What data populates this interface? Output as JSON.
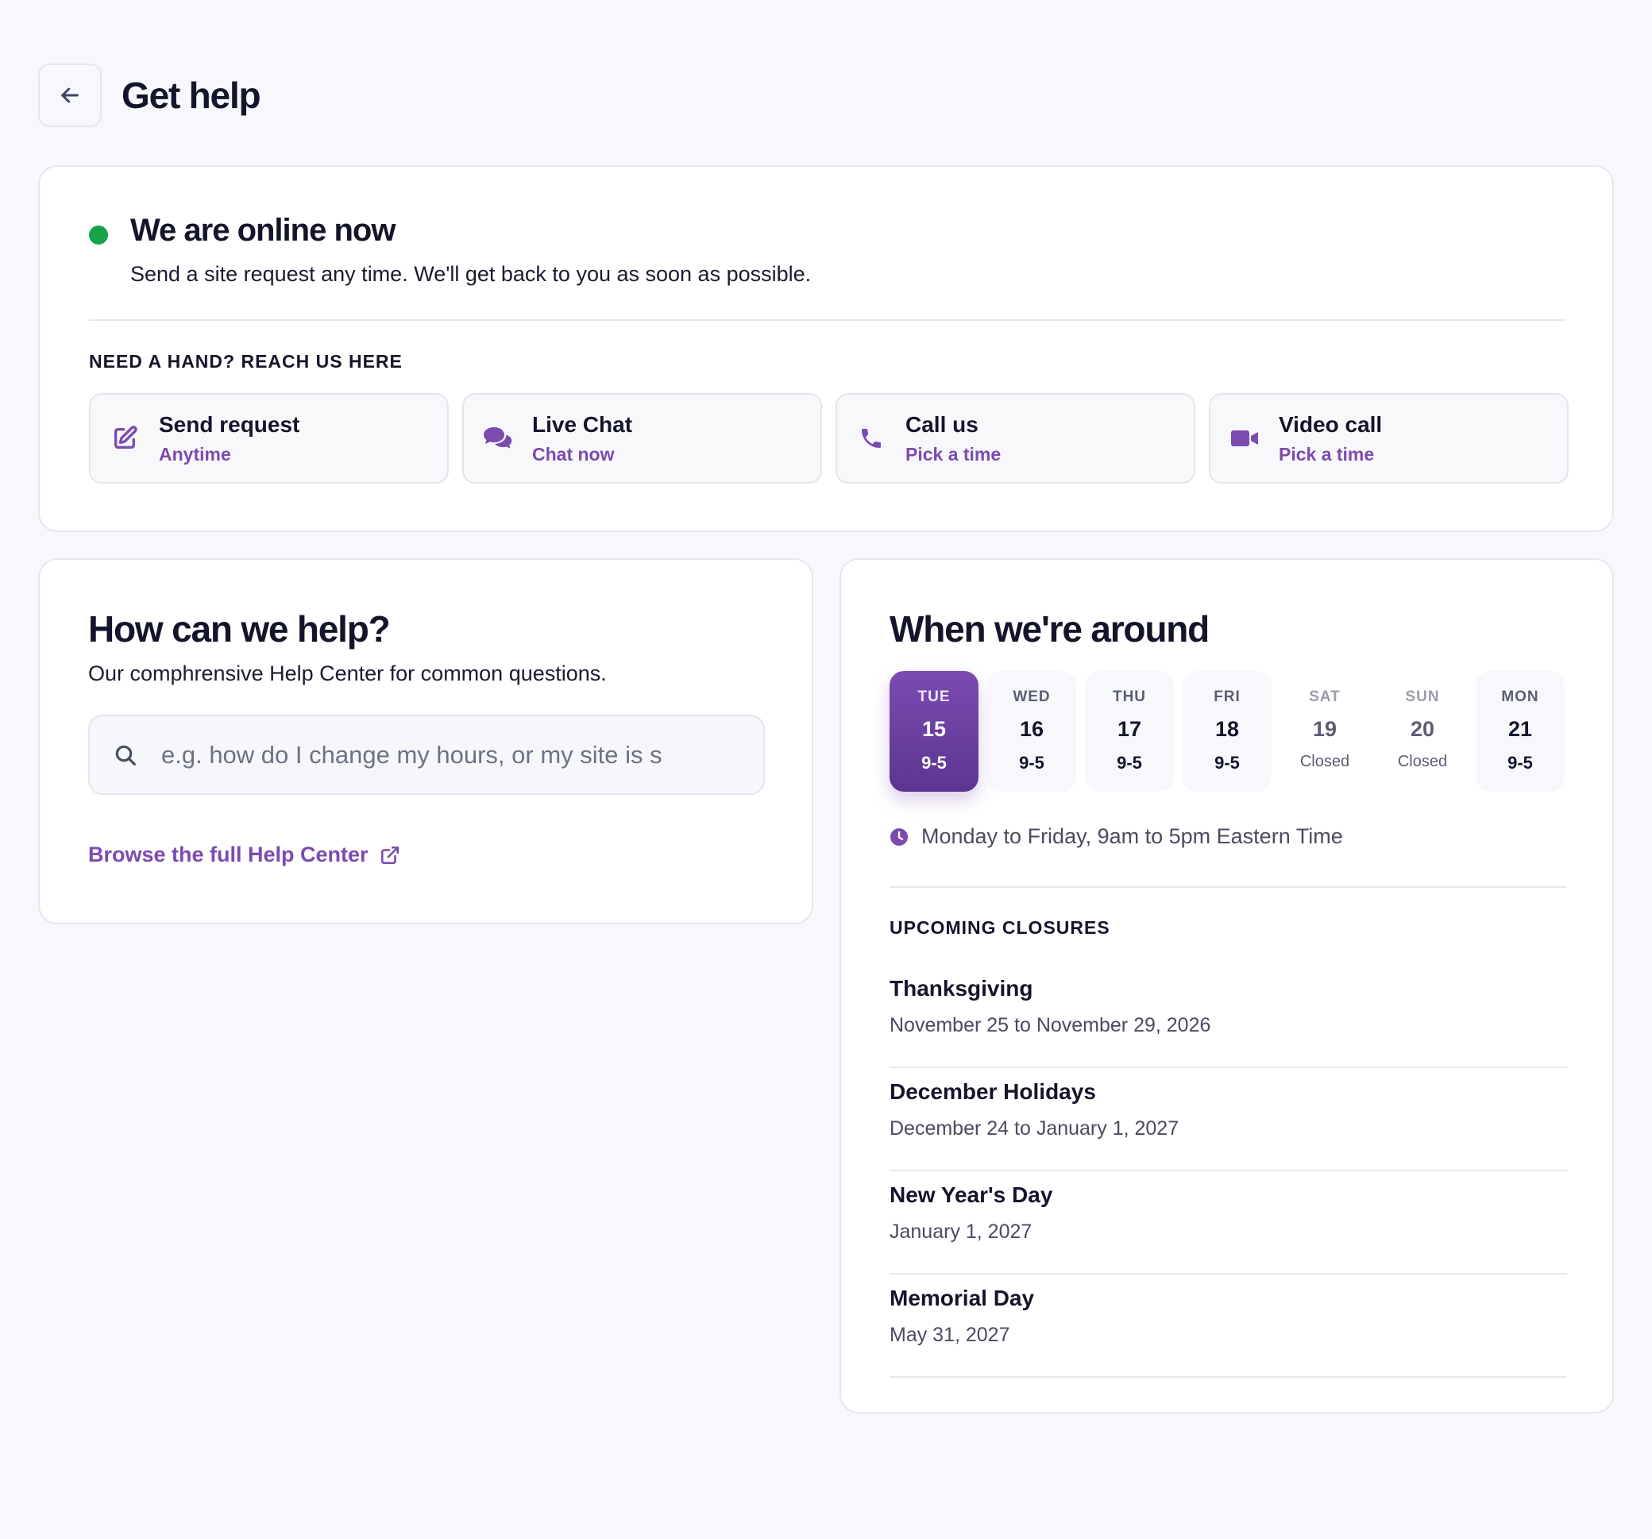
{
  "header": {
    "title": "Get help"
  },
  "status": {
    "title": "We are online now",
    "subtitle": "Send a site request any time. We'll get back to you as soon as possible.",
    "dot_color": "#16a34a",
    "reach_label": "NEED A HAND? REACH US HERE",
    "channels": [
      {
        "title": "Send request",
        "action": "Anytime",
        "icon": "edit-icon"
      },
      {
        "title": "Live Chat",
        "action": "Chat now",
        "icon": "chat-icon"
      },
      {
        "title": "Call us",
        "action": "Pick a time",
        "icon": "phone-icon"
      },
      {
        "title": "Video call",
        "action": "Pick a time",
        "icon": "video-icon"
      }
    ]
  },
  "help": {
    "title": "How can we help?",
    "subtitle": "Our comphrensive Help Center for common questions.",
    "search_placeholder": "e.g. how do I change my hours, or my site is s",
    "browse_link": "Browse the full Help Center"
  },
  "hours": {
    "title": "When we're around",
    "days": [
      {
        "name": "TUE",
        "num": "15",
        "hours": "9-5",
        "state": "active"
      },
      {
        "name": "WED",
        "num": "16",
        "hours": "9-5",
        "state": "open"
      },
      {
        "name": "THU",
        "num": "17",
        "hours": "9-5",
        "state": "open"
      },
      {
        "name": "FRI",
        "num": "18",
        "hours": "9-5",
        "state": "open"
      },
      {
        "name": "SAT",
        "num": "19",
        "hours": "Closed",
        "state": "closed"
      },
      {
        "name": "SUN",
        "num": "20",
        "hours": "Closed",
        "state": "closed"
      },
      {
        "name": "MON",
        "num": "21",
        "hours": "9-5",
        "state": "open"
      }
    ],
    "note": "Monday to Friday, 9am to 5pm Eastern Time",
    "closures_label": "UPCOMING CLOSURES",
    "closures": [
      {
        "name": "Thanksgiving",
        "dates": "November 25 to November 29, 2026"
      },
      {
        "name": "December Holidays",
        "dates": "December 24 to January 1, 2027"
      },
      {
        "name": "New Year's Day",
        "dates": "January 1, 2027"
      },
      {
        "name": "Memorial Day",
        "dates": "May 31, 2027"
      }
    ]
  },
  "colors": {
    "accent": "#7b4bb0",
    "online": "#16a34a",
    "text": "#14142b"
  }
}
